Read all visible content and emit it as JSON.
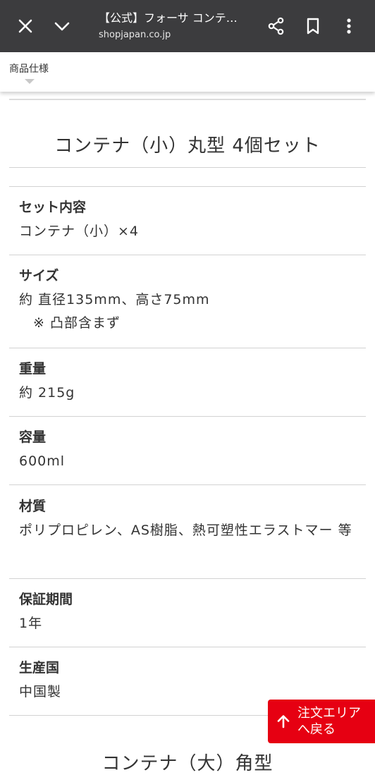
{
  "browser": {
    "page_title": "【公式】フォーサ コンテ…",
    "url": "shopjapan.co.jp",
    "icons": [
      "close-icon",
      "chevron-down-icon",
      "share-icon",
      "bookmark-icon",
      "more-vert-icon"
    ]
  },
  "subnav": {
    "label": "商品仕様"
  },
  "product": {
    "title": "コンテナ（小）丸型 4個セット"
  },
  "specs": {
    "set_contents": {
      "label": "セット内容",
      "value": "コンテナ（小）×4"
    },
    "size": {
      "label": "サイズ",
      "value": "約 直径135mm、高さ75mm",
      "note": "※ 凸部含まず"
    },
    "weight": {
      "label": "重量",
      "value": "約 215g"
    },
    "capacity": {
      "label": "容量",
      "value": "600ml"
    },
    "material": {
      "label": "材質",
      "value": "ポリプロピレン、AS樹脂、熱可塑性エラストマー 等"
    },
    "warranty": {
      "label": "保証期間",
      "value": "1年"
    },
    "origin": {
      "label": "生産国",
      "value": "中国製"
    }
  },
  "order_button": {
    "line1": "注文エリア",
    "line2": "へ戻る",
    "icon": "arrow-up-icon",
    "color": "#e60012"
  },
  "next_section": {
    "title": "コンテナ（大）角型"
  },
  "colors": {
    "topbar": "#3c3c3e",
    "accent": "#e60012"
  }
}
